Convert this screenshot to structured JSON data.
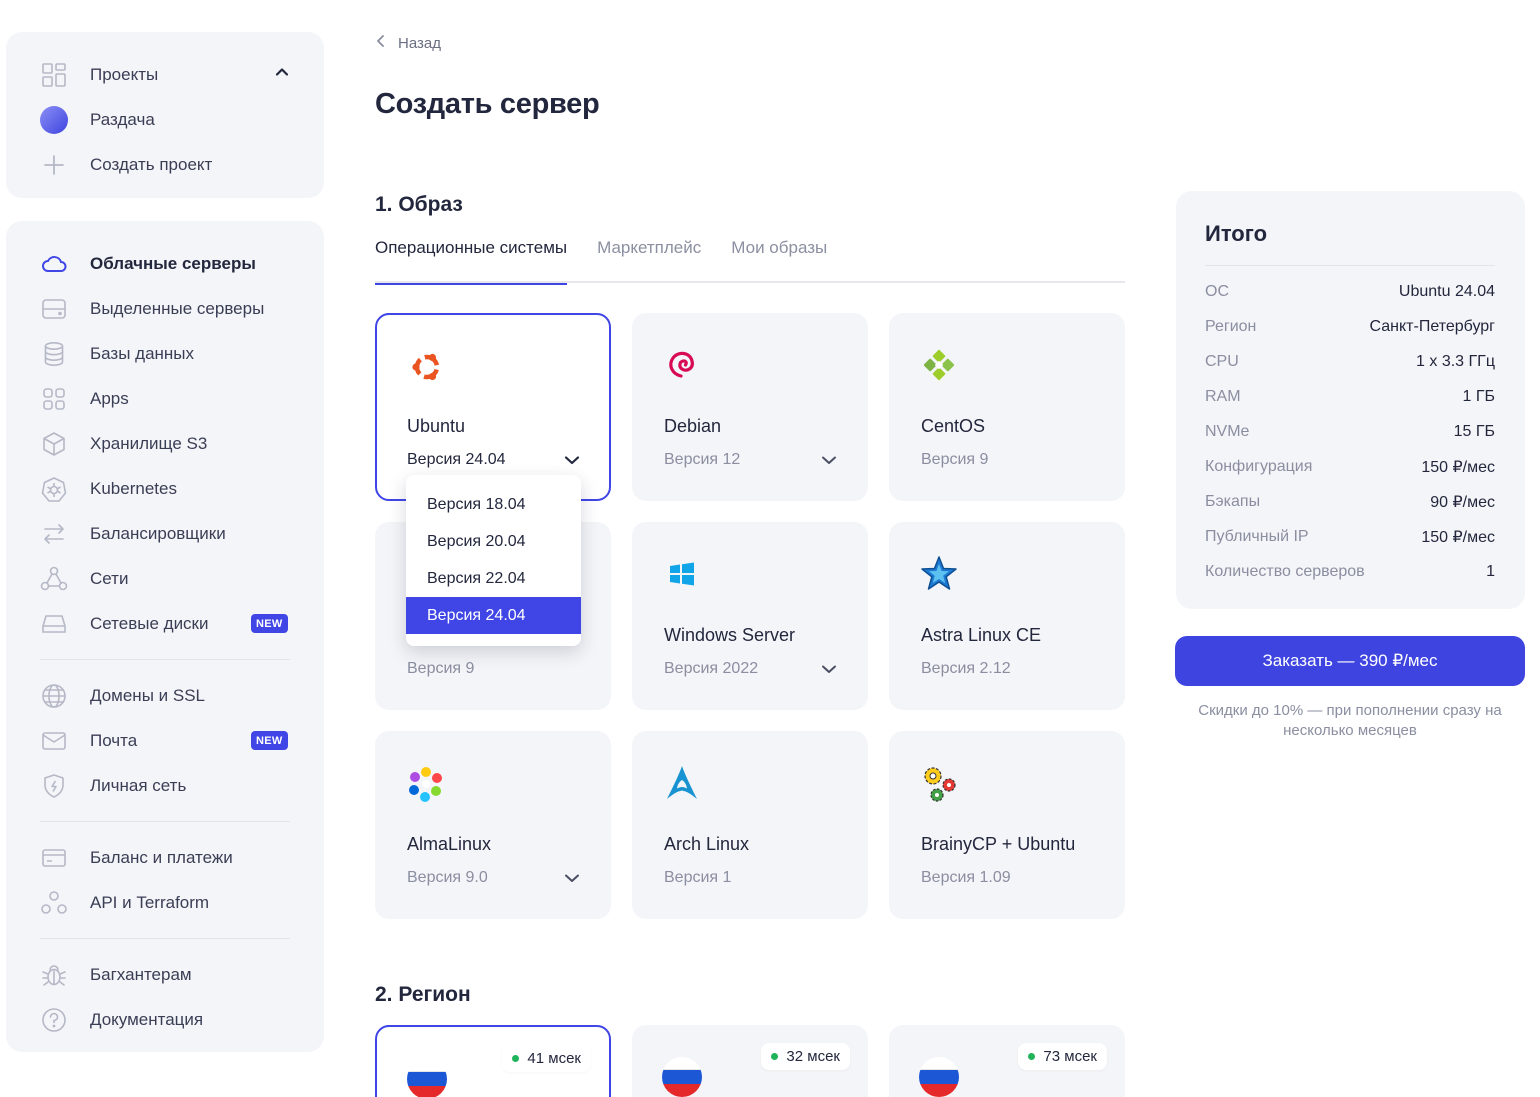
{
  "sidebar": {
    "top": [
      {
        "label": "Проекты",
        "icon": "grid-icon"
      },
      {
        "label": "Раздача",
        "icon": "project-avatar-icon"
      },
      {
        "label": "Создать проект",
        "icon": "plus-icon"
      }
    ],
    "main": [
      {
        "label": "Облачные серверы",
        "icon": "cloud-icon"
      },
      {
        "label": "Выделенные серверы",
        "icon": "server-icon"
      },
      {
        "label": "Базы данных",
        "icon": "database-icon"
      },
      {
        "label": "Apps",
        "icon": "apps-icon"
      },
      {
        "label": "Хранилище S3",
        "icon": "cube-icon"
      },
      {
        "label": "Kubernetes",
        "icon": "kubernetes-icon"
      },
      {
        "label": "Балансировщики",
        "icon": "arrows-icon"
      },
      {
        "label": "Сети",
        "icon": "network-icon"
      },
      {
        "label": "Сетевые диски",
        "icon": "disk-icon",
        "badge": "NEW"
      },
      {
        "label": "Домены и SSL",
        "icon": "globe-icon"
      },
      {
        "label": "Почта",
        "icon": "mail-icon",
        "badge": "NEW"
      },
      {
        "label": "Личная сеть",
        "icon": "shield-icon"
      },
      {
        "label": "Баланс и платежи",
        "icon": "card-icon"
      },
      {
        "label": "API и Terraform",
        "icon": "api-icon"
      },
      {
        "label": "Багхантерам",
        "icon": "bug-icon"
      },
      {
        "label": "Документация",
        "icon": "help-icon"
      }
    ]
  },
  "header": {
    "back_label": "Назад",
    "title": "Создать сервер"
  },
  "image_section": {
    "title": "1. Образ",
    "tabs": [
      "Операционные системы",
      "Маркетплейс",
      "Мои образы"
    ],
    "active_tab": 0
  },
  "os_cards": [
    {
      "name": "Ubuntu",
      "version": "Версия 24.04",
      "dropdown": true,
      "selected": true
    },
    {
      "name": "Debian",
      "version": "Версия 12",
      "dropdown": true
    },
    {
      "name": "CentOS",
      "version": "Версия 9",
      "dropdown": false
    },
    {
      "name": "",
      "version": "Версия 9",
      "dropdown": false
    },
    {
      "name": "Windows Server",
      "version": "Версия 2022",
      "dropdown": true
    },
    {
      "name": "Astra Linux CE",
      "version": "Версия 2.12",
      "dropdown": false
    },
    {
      "name": "AlmaLinux",
      "version": "Версия 9.0",
      "dropdown": true
    },
    {
      "name": "Arch Linux",
      "version": "Версия 1",
      "dropdown": false
    },
    {
      "name": "BrainyCP + Ubuntu",
      "version": "Версия 1.09",
      "dropdown": false
    }
  ],
  "version_dropdown": {
    "options": [
      "Версия 18.04",
      "Версия 20.04",
      "Версия 22.04",
      "Версия 24.04"
    ],
    "selected": "Версия 24.04"
  },
  "region_section": {
    "title": "2. Регион",
    "regions": [
      {
        "ping": "41 мсек",
        "selected": true
      },
      {
        "ping": "32 мсек"
      },
      {
        "ping": "73 мсек"
      }
    ]
  },
  "summary": {
    "title": "Итого",
    "rows": [
      {
        "key": "ОС",
        "value": "Ubuntu 24.04"
      },
      {
        "key": "Регион",
        "value": "Санкт-Петербург"
      },
      {
        "key": "CPU",
        "value": "1 x 3.3 ГГц"
      },
      {
        "key": "RAM",
        "value": "1 ГБ"
      },
      {
        "key": "NVMe",
        "value": "15 ГБ"
      },
      {
        "key": "Конфигурация",
        "value": "150 ₽/мес"
      },
      {
        "key": "Бэкапы",
        "value": "90 ₽/мес"
      },
      {
        "key": "Публичный IP",
        "value": "150 ₽/мес"
      },
      {
        "key": "Количество серверов",
        "value": "1"
      }
    ],
    "order_label": "Заказать — 390 ₽/мес",
    "discount_text": "Скидки до 10% — при пополнении сразу на несколько месяцев"
  },
  "colors": {
    "accent": "#4046e6",
    "card_bg": "#f4f5f8",
    "text": "#23273d",
    "muted": "#8a8ea0"
  }
}
